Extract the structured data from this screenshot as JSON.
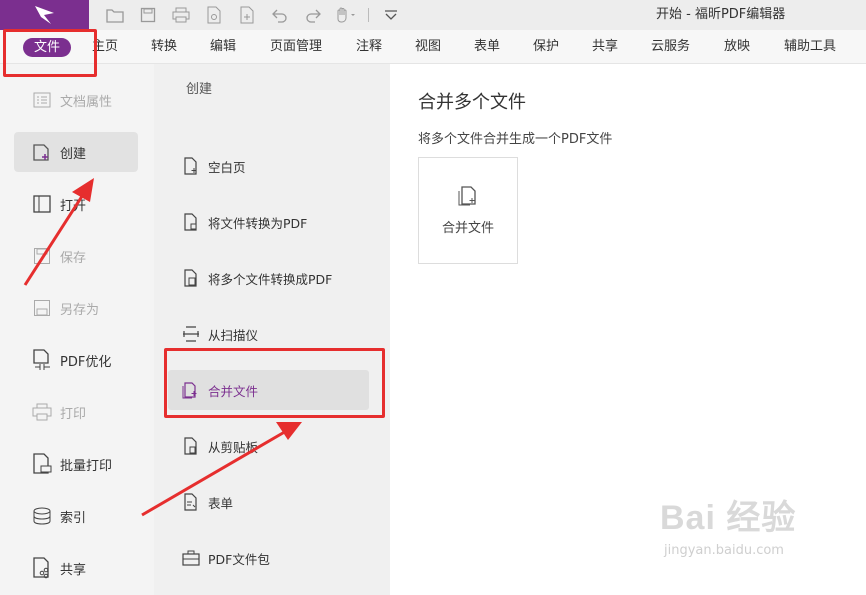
{
  "window": {
    "title": "开始 - 福昕PDF编辑器"
  },
  "quick_access": {
    "icons": [
      "open-icon",
      "save-icon",
      "print-icon",
      "scan-icon",
      "create-icon",
      "undo-icon",
      "redo-icon",
      "hand-icon",
      "customize-icon"
    ]
  },
  "menubar": {
    "file": "文件",
    "items": [
      "主页",
      "转换",
      "编辑",
      "页面管理",
      "注释",
      "视图",
      "表单",
      "保护",
      "共享",
      "云服务",
      "放映",
      "辅助工具"
    ]
  },
  "left_panel": {
    "items": [
      {
        "label": "文档属性",
        "icon": "document-properties-icon",
        "disabled": true
      },
      {
        "label": "创建",
        "icon": "create-icon",
        "selected": true
      },
      {
        "label": "打开",
        "icon": "open-book-icon"
      },
      {
        "label": "保存",
        "icon": "save-icon",
        "disabled": true
      },
      {
        "label": "另存为",
        "icon": "save-as-icon",
        "disabled": true
      },
      {
        "label": "PDF优化",
        "icon": "pdf-optimize-icon"
      },
      {
        "label": "打印",
        "icon": "print-icon",
        "disabled": true
      },
      {
        "label": "批量打印",
        "icon": "batch-print-icon"
      },
      {
        "label": "索引",
        "icon": "index-icon"
      },
      {
        "label": "共享",
        "icon": "share-icon"
      }
    ]
  },
  "middle_panel": {
    "heading": "创建",
    "items": [
      {
        "label": "空白页",
        "icon": "blank-page-icon"
      },
      {
        "label": "将文件转换为PDF",
        "icon": "file-to-pdf-icon"
      },
      {
        "label": "将多个文件转换成PDF",
        "icon": "multi-file-to-pdf-icon"
      },
      {
        "label": "从扫描仪",
        "icon": "scanner-icon"
      },
      {
        "label": "合并文件",
        "icon": "merge-files-icon",
        "selected": true
      },
      {
        "label": "从剪贴板",
        "icon": "clipboard-icon"
      },
      {
        "label": "表单",
        "icon": "form-icon"
      },
      {
        "label": "PDF文件包",
        "icon": "pdf-portfolio-icon"
      }
    ]
  },
  "content": {
    "title": "合并多个文件",
    "subtitle": "将多个文件合并生成一个PDF文件",
    "tile_label": "合并文件"
  },
  "watermark": {
    "text": "Bai 经验",
    "url": "jingyan.baidu.com"
  },
  "colors": {
    "brand": "#7b2f8f",
    "annotation": "#e62e2e"
  }
}
